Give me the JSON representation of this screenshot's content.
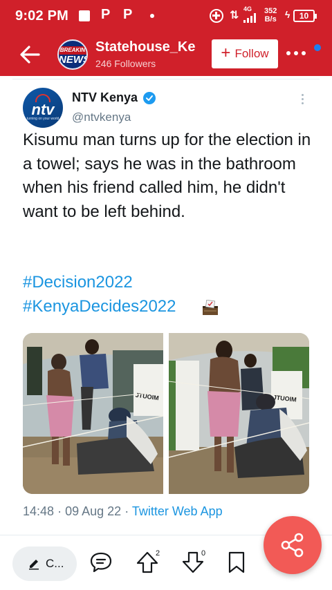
{
  "status_bar": {
    "time": "9:02 PM",
    "network": "4G",
    "speed_value": "352",
    "speed_unit": "B/s",
    "battery": "10"
  },
  "header": {
    "avatar_line1": "BREAKIN",
    "avatar_line2": "NEWS",
    "name": "Statehouse_Ke",
    "followers": "246 Followers",
    "follow_label": "Follow",
    "accent_color": "#d0202a"
  },
  "tweet": {
    "author_name": "NTV Kenya",
    "author_handle": "@ntvkenya",
    "avatar_logo": "ntv",
    "avatar_tagline": "turning on your world",
    "text": "Kisumu man turns up for the election in a towel; says he was in the bathroom when his friend called him, he didn't want to be left behind.",
    "hashtags": [
      "#Decision2022",
      "#KenyaDecides2022"
    ],
    "time": "14:48",
    "date": "09 Aug 22",
    "separator": "·",
    "source": "Twitter Web App",
    "link_color": "#1b95e0"
  },
  "photos": {
    "left_sign": "JTUOIM",
    "right_sign": "JTUOIM"
  },
  "actions": {
    "comment_label": "C...",
    "retweet_count": "2",
    "downvote_count": "0",
    "icons": [
      "pencil-icon",
      "comment-icon",
      "upvote-icon",
      "downvote-icon",
      "bookmark-icon",
      "share-icon"
    ]
  }
}
